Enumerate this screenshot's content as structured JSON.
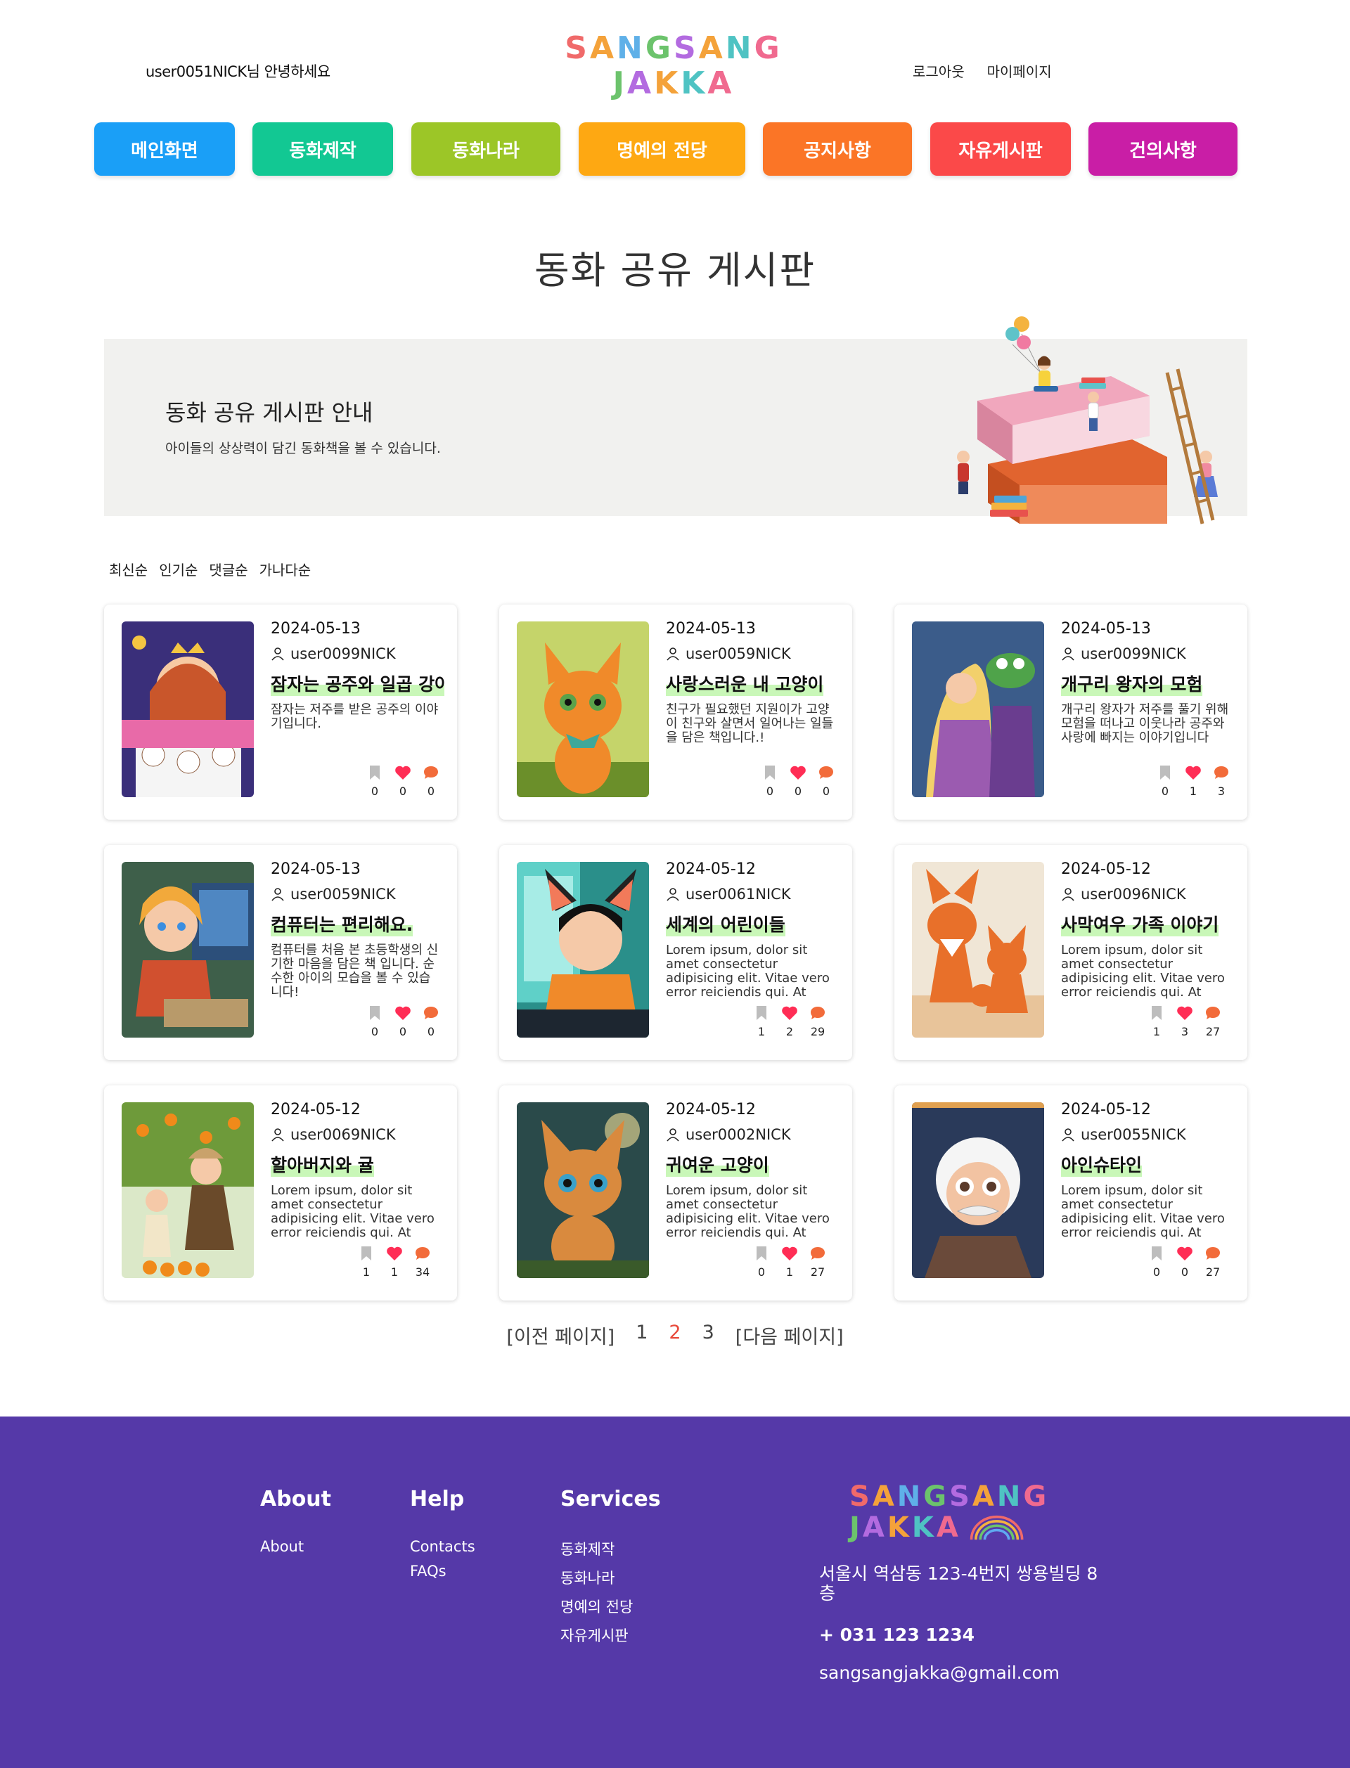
{
  "header": {
    "greeting": "user0051NICK님 안녕하세요",
    "logo_line1": "SANGSANG",
    "logo_line2": "JAKKA",
    "logout": "로그아웃",
    "mypage": "마이페이지"
  },
  "nav": [
    {
      "label": "메인화면",
      "color": "#1a9ff7"
    },
    {
      "label": "동화제작",
      "color": "#12c893"
    },
    {
      "label": "동화나라",
      "color": "#9cc627"
    },
    {
      "label": "명예의 전당",
      "color": "#fea812"
    },
    {
      "label": "공지사항",
      "color": "#fb7526"
    },
    {
      "label": "자유게시판",
      "color": "#fb4949"
    },
    {
      "label": "건의사항",
      "color": "#c91ea6"
    }
  ],
  "page_title": "동화 공유 게시판",
  "banner": {
    "title": "동화 공유 게시판 안내",
    "description": "아이들의 상상력이 담긴 동화책을 볼 수 있습니다."
  },
  "sort": [
    "최신순",
    "인기순",
    "댓글순",
    "가나다순"
  ],
  "cards": [
    {
      "date": "2024-05-13",
      "author": "user0099NICK",
      "title": "잠자는 공주와 일곱 강아지",
      "desc": "잠자는 저주를 받은 공주의 이야기입니다.",
      "bookmarks": "0",
      "likes": "0",
      "comments": "0"
    },
    {
      "date": "2024-05-13",
      "author": "user0059NICK",
      "title": "사랑스러운 내 고양이",
      "desc": "친구가 필요했던 지원이가 고양이 친구와 살면서 일어나는 일들을 담은 책입니다.!",
      "bookmarks": "0",
      "likes": "0",
      "comments": "0"
    },
    {
      "date": "2024-05-13",
      "author": "user0099NICK",
      "title": "개구리 왕자의 모험",
      "desc": "개구리 왕자가 저주를 풀기 위해 모험을 떠나고 이웃나라 공주와 사랑에 빠지는 이야기입니다",
      "bookmarks": "0",
      "likes": "1",
      "comments": "3"
    },
    {
      "date": "2024-05-13",
      "author": "user0059NICK",
      "title": "컴퓨터는 편리해요.",
      "desc": "컴퓨터를 처음 본 초등학생의 신기한 마음을 담은 책 입니다. 순수한 아이의 모습을 볼 수 있습니다!",
      "bookmarks": "0",
      "likes": "0",
      "comments": "0"
    },
    {
      "date": "2024-05-12",
      "author": "user0061NICK",
      "title": "세계의 어린이들",
      "desc": "Lorem ipsum, dolor sit amet consectetur adipisicing elit. Vitae vero error reiciendis qui. At",
      "bookmarks": "1",
      "likes": "2",
      "comments": "29"
    },
    {
      "date": "2024-05-12",
      "author": "user0096NICK",
      "title": "사막여우 가족 이야기",
      "desc": "Lorem ipsum, dolor sit amet consectetur adipisicing elit. Vitae vero error reiciendis qui. At",
      "bookmarks": "1",
      "likes": "3",
      "comments": "27"
    },
    {
      "date": "2024-05-12",
      "author": "user0069NICK",
      "title": "할아버지와 귤",
      "desc": "Lorem ipsum, dolor sit amet consectetur adipisicing elit. Vitae vero error reiciendis qui. At",
      "bookmarks": "1",
      "likes": "1",
      "comments": "34"
    },
    {
      "date": "2024-05-12",
      "author": "user0002NICK",
      "title": "귀여운 고양이",
      "desc": "Lorem ipsum, dolor sit amet consectetur adipisicing elit. Vitae vero error reiciendis qui. At",
      "bookmarks": "0",
      "likes": "1",
      "comments": "27"
    },
    {
      "date": "2024-05-12",
      "author": "user0055NICK",
      "title": "아인슈타인",
      "desc": "Lorem ipsum, dolor sit amet consectetur adipisicing elit. Vitae vero error reiciendis qui. At",
      "bookmarks": "0",
      "likes": "0",
      "comments": "27"
    }
  ],
  "pager": {
    "prev": "[이전 페이지]",
    "pages": [
      "1",
      "2",
      "3"
    ],
    "current": "2",
    "next": "[다음 페이지]"
  },
  "footer": {
    "about": {
      "heading": "About",
      "links": [
        "About"
      ]
    },
    "help": {
      "heading": "Help",
      "links": [
        "Contacts",
        "FAQs"
      ]
    },
    "services": {
      "heading": "Services",
      "links": [
        "동화제작",
        "동화나라",
        "명예의 전당",
        "자유게시판"
      ]
    },
    "logo_line1": "SANGSANG",
    "logo_line2": "JAKKA",
    "address": "서울시 역삼동 123-4번지 쌍용빌딩 8층",
    "phone": "+ 031 123 1234",
    "email": "sangsangjakka@gmail.com"
  },
  "colors": {
    "footer_bg": "#5539a8",
    "title_highlight": "#c9f7b8",
    "current_page": "#e84a3c",
    "like_icon": "#ff2d55",
    "comment_icon": "#f26b3a",
    "bookmark_icon": "#bdbdbd"
  }
}
